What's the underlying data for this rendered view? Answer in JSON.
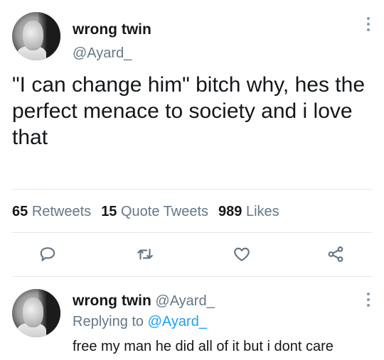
{
  "tweet": {
    "author_name": "wrong twin",
    "author_handle": "@Ayard_",
    "text": "\"I can change him\" bitch why, hes the perfect menace to society and i love that",
    "stats": {
      "retweets_count": "65",
      "retweets_label": "Retweets",
      "quotes_count": "15",
      "quotes_label": "Quote Tweets",
      "likes_count": "989",
      "likes_label": "Likes"
    },
    "actions": [
      "reply-icon",
      "retweet-icon",
      "like-icon",
      "share-icon"
    ]
  },
  "reply": {
    "author_name": "wrong twin",
    "author_handle": "@Ayard_",
    "replying_prefix": "Replying to",
    "replying_handle": "@Ayard_",
    "text": "free my man he did all of it but i dont care"
  },
  "colors": {
    "text": "#14171a",
    "muted": "#657786",
    "link": "#1da1f2",
    "divider": "#e1e8ed"
  }
}
